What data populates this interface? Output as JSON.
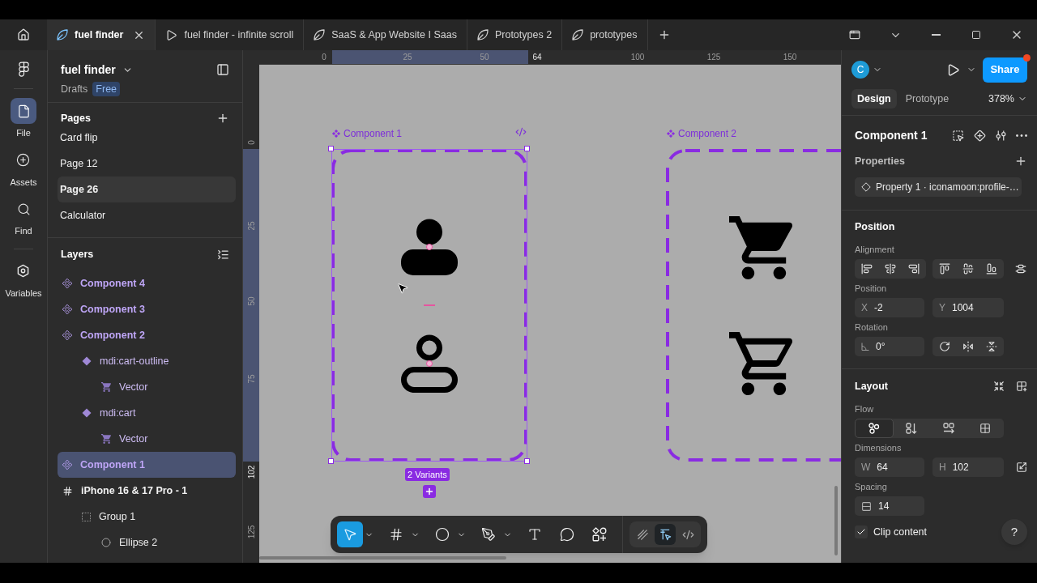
{
  "tabs": {
    "items": [
      {
        "label": "fuel finder",
        "kind": "design",
        "selected": true
      },
      {
        "label": "fuel finder - infinite scroll",
        "kind": "prototype",
        "selected": false
      },
      {
        "label": "SaaS & App Website I Saas",
        "kind": "design",
        "selected": false
      },
      {
        "label": "Prototypes 2",
        "kind": "design",
        "selected": false
      },
      {
        "label": "prototypes",
        "kind": "design",
        "selected": false
      }
    ]
  },
  "rail": {
    "items": [
      {
        "label": "File",
        "kind": "file",
        "selected": true
      },
      {
        "label": "Assets",
        "kind": "assets",
        "selected": false
      },
      {
        "label": "Find",
        "kind": "find",
        "selected": false
      },
      {
        "label": "Variables",
        "kind": "variables",
        "selected": false
      }
    ]
  },
  "file": {
    "name": "fuel finder",
    "location": "Drafts",
    "plan": "Free"
  },
  "pages": {
    "title": "Pages",
    "items": [
      {
        "label": "Card flip",
        "selected": false
      },
      {
        "label": "Page 12",
        "selected": false
      },
      {
        "label": "Page 26",
        "selected": true
      },
      {
        "label": "Calculator",
        "selected": false
      }
    ]
  },
  "layers": {
    "title": "Layers",
    "items": [
      {
        "label": "Component 4",
        "kind": "component",
        "selected": false
      },
      {
        "label": "Component 3",
        "kind": "component",
        "selected": false
      },
      {
        "label": "Component 2",
        "kind": "component",
        "selected": false,
        "children": [
          {
            "label": "mdi:cart-outline",
            "kind": "variant",
            "selected": false,
            "children": [
              {
                "label": "Vector",
                "kind": "vector",
                "selected": false
              }
            ]
          },
          {
            "label": "mdi:cart",
            "kind": "variant",
            "selected": false,
            "children": [
              {
                "label": "Vector",
                "kind": "vector",
                "selected": false
              }
            ]
          }
        ]
      },
      {
        "label": "Component 1",
        "kind": "component",
        "selected": true
      },
      {
        "label": "iPhone 16 & 17 Pro - 1",
        "kind": "frame",
        "selected": false,
        "children": [
          {
            "label": "Group 1",
            "kind": "group",
            "selected": false,
            "children": [
              {
                "label": "Ellipse 2",
                "kind": "ellipse",
                "selected": false
              }
            ]
          }
        ]
      }
    ]
  },
  "canvas": {
    "ruler_x": [
      {
        "label": "0",
        "kind": "tick"
      },
      {
        "label": "25",
        "kind": "tick"
      },
      {
        "label": "50",
        "kind": "tick"
      },
      {
        "label": "64",
        "kind": "edge"
      },
      {
        "label": "100",
        "kind": "tick"
      },
      {
        "label": "125",
        "kind": "tick"
      },
      {
        "label": "150",
        "kind": "tick"
      }
    ],
    "ruler_y": [
      {
        "label": "0",
        "kind": "tick"
      },
      {
        "label": "25",
        "kind": "tick"
      },
      {
        "label": "50",
        "kind": "tick"
      },
      {
        "label": "75",
        "kind": "tick"
      },
      {
        "label": "102",
        "kind": "edge"
      },
      {
        "label": "125",
        "kind": "tick"
      }
    ],
    "frames": [
      {
        "label": "Component 1",
        "selected": true,
        "badge": "2 Variants"
      },
      {
        "label": "Component 2",
        "selected": false
      }
    ]
  },
  "toolbar": {
    "tools": [
      {
        "kind": "move",
        "selected": true
      },
      {
        "kind": "frame",
        "selected": false
      },
      {
        "kind": "shape",
        "selected": false
      },
      {
        "kind": "pen",
        "selected": false
      },
      {
        "kind": "text",
        "selected": false
      },
      {
        "kind": "comment",
        "selected": false
      },
      {
        "kind": "actions",
        "selected": false
      }
    ],
    "modes": [
      {
        "kind": "draw",
        "selected": false
      },
      {
        "kind": "design",
        "selected": true
      },
      {
        "kind": "dev",
        "selected": false
      }
    ]
  },
  "inspector": {
    "avatar": "C",
    "share": "Share",
    "tabs": [
      {
        "label": "Design",
        "selected": true
      },
      {
        "label": "Prototype",
        "selected": false
      }
    ],
    "zoom": "378%",
    "selection": "Component 1",
    "properties": {
      "title": "Properties",
      "items": [
        {
          "label": "Property 1 · iconamoon:profile-…"
        }
      ]
    },
    "position": {
      "title": "Position",
      "alignment_label": "Alignment",
      "position_label": "Position",
      "x": {
        "label": "X",
        "value": "-2"
      },
      "y": {
        "label": "Y",
        "value": "1004"
      },
      "rotation_label": "Rotation",
      "rotation": {
        "value": "0°"
      }
    },
    "layout": {
      "title": "Layout",
      "flow_label": "Flow",
      "flow": [
        {
          "kind": "freeform",
          "selected": true
        },
        {
          "kind": "vertical",
          "selected": false
        },
        {
          "kind": "horizontal",
          "selected": false
        },
        {
          "kind": "grid",
          "selected": false
        }
      ],
      "dimensions_label": "Dimensions",
      "width": {
        "label": "W",
        "value": "64"
      },
      "height": {
        "label": "H",
        "value": "102"
      },
      "spacing_label": "Spacing",
      "spacing": {
        "value": "14"
      },
      "clip_content": {
        "label": "Clip content",
        "checked": true
      }
    },
    "help": "?"
  }
}
